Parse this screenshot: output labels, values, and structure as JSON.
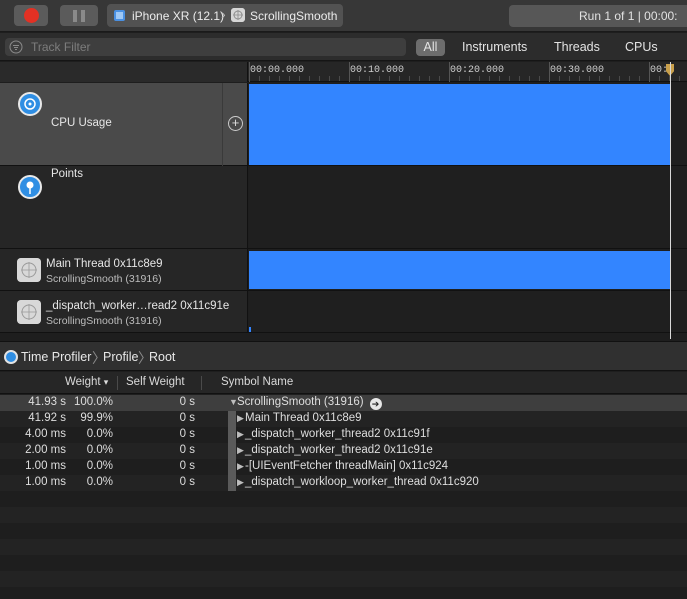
{
  "toolbar": {
    "device": "iPhone XR (12.1)",
    "app": "ScrollingSmooth",
    "run_status": "Run 1 of 1  |  00:00:"
  },
  "filter": {
    "placeholder": "Track Filter",
    "tabs": [
      "All",
      "Instruments",
      "Threads",
      "CPUs"
    ]
  },
  "ruler": {
    "ticks": [
      "00:00.000",
      "00:10.000",
      "00:20.000",
      "00:30.000",
      "00:0"
    ]
  },
  "tracks": {
    "cpu": {
      "title": "CPU Usage"
    },
    "points": {
      "title": "Points"
    },
    "main": {
      "title": "Main Thread  0x11c8e9",
      "sub": "ScrollingSmooth (31916)"
    },
    "dispatch": {
      "title": "_dispatch_worker…read2  0x11c91e",
      "sub": "ScrollingSmooth (31916)"
    }
  },
  "breadcrumb": {
    "items": [
      "Time Profiler",
      "Profile",
      "Root"
    ]
  },
  "table": {
    "headers": {
      "weight": "Weight",
      "self_weight": "Self Weight",
      "symbol": "Symbol Name"
    },
    "rows": [
      {
        "weight": "41.93 s",
        "pct": "100.0%",
        "self": "0 s",
        "symbol": "ScrollingSmooth (31916)"
      },
      {
        "weight": "41.92 s",
        "pct": "99.9%",
        "self": "0 s",
        "symbol": "Main Thread  0x11c8e9"
      },
      {
        "weight": "4.00 ms",
        "pct": "0.0%",
        "self": "0 s",
        "symbol": "_dispatch_worker_thread2  0x11c91f"
      },
      {
        "weight": "2.00 ms",
        "pct": "0.0%",
        "self": "0 s",
        "symbol": "_dispatch_worker_thread2  0x11c91e"
      },
      {
        "weight": "1.00 ms",
        "pct": "0.0%",
        "self": "0 s",
        "symbol": "-[UIEventFetcher threadMain]  0x11c924"
      },
      {
        "weight": "1.00 ms",
        "pct": "0.0%",
        "self": "0 s",
        "symbol": "_dispatch_workloop_worker_thread  0x11c920"
      }
    ]
  },
  "colors": {
    "accent": "#3385ff",
    "record": "#e33124"
  },
  "icons": [
    "record-icon",
    "pause-icon",
    "phone-icon",
    "app-icon",
    "filter-icon",
    "gauge-icon",
    "pin-icon",
    "thread-icon",
    "add-icon",
    "go-arrow-icon"
  ]
}
